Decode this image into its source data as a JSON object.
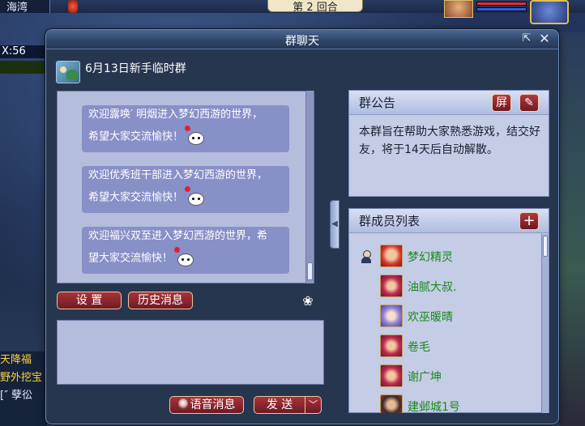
{
  "hud": {
    "map_name": "海湾",
    "round_text": "第 2 回合",
    "coords": "X:56",
    "left_chat": [
      {
        "text": "天降福",
        "color": "#ffd040"
      },
      {
        "text": "野外挖宝",
        "color": "#ffd040"
      },
      {
        "text": "[″ 孽彸",
        "color": "#e0e8ff"
      }
    ],
    "hp_color": "#e03030",
    "mp_color": "#3060e0"
  },
  "dialog": {
    "title": "群聊天",
    "group_name": "6月13日新手临时群",
    "messages": [
      {
        "line1": "欢迎露唤′ 明烟进入梦幻西游的世界，",
        "line2": "希望大家交流愉快！"
      },
      {
        "line1": "欢迎优秀班干部进入梦幻西游的世界，",
        "line2": "希望大家交流愉快！"
      },
      {
        "line1": "欢迎福兴双至进入梦幻西游的世界，希",
        "line2": "望大家交流愉快！"
      }
    ],
    "settings_label": "设 置",
    "history_label": "历史消息",
    "voice_label": "语音消息",
    "send_label": "发 送",
    "send_arrow": "﹀"
  },
  "notice": {
    "title": "群公告",
    "block_label": "屏",
    "edit_label": "✎",
    "text": "本群旨在帮助大家熟悉游戏，结交好友，将于14天后自动解散。"
  },
  "members": {
    "title": "群成员列表",
    "add_label": "+",
    "name_color": "#1a8a1a",
    "list": [
      {
        "name": "梦幻精灵",
        "admin": true,
        "avatar": "red-hair-girl"
      },
      {
        "name": "油腻大叔.",
        "admin": false,
        "avatar": "red-hair-boy"
      },
      {
        "name": "欢巫暖晴",
        "admin": false,
        "avatar": "purple-hair-girl"
      },
      {
        "name": "卷毛",
        "admin": false,
        "avatar": "red-hair-boy"
      },
      {
        "name": "谢广坤",
        "admin": false,
        "avatar": "red-hair-boy"
      },
      {
        "name": "建邺城1号",
        "admin": false,
        "avatar": "dark-hair-warrior"
      }
    ]
  }
}
